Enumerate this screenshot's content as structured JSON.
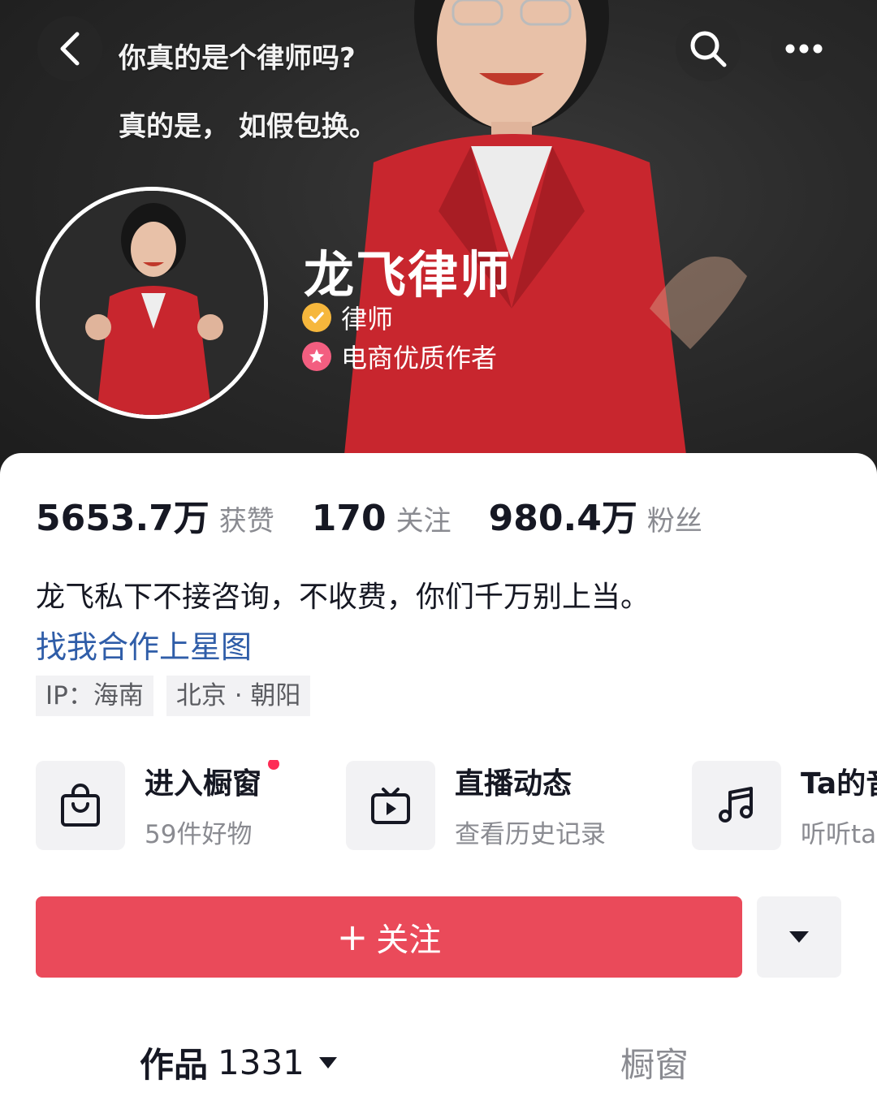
{
  "header": {
    "caption_line1": "你真的是个律师吗?",
    "caption_line2": "真的是， 如假包换。",
    "icons": [
      "chevron-left-icon",
      "search-icon",
      "more-icon"
    ]
  },
  "profile": {
    "name": "龙飞律师",
    "badges": [
      {
        "label": "律师",
        "icon": "verified-check-icon",
        "color": "#f6b73c"
      },
      {
        "label": "电商优质作者",
        "icon": "star-badge-icon",
        "color": "#f35e80"
      }
    ]
  },
  "stats": [
    {
      "value": "5653.7万",
      "label": "获赞"
    },
    {
      "value": "170",
      "label": "关注"
    },
    {
      "value": "980.4万",
      "label": "粉丝"
    }
  ],
  "bio": {
    "text": "龙飞私下不接咨询，不收费，你们千万别上当。",
    "link": "找我合作上星图"
  },
  "chips": [
    "IP：海南",
    "北京 · 朝阳"
  ],
  "features": [
    {
      "title": "进入橱窗",
      "subtitle": "59件好物",
      "icon": "shopping-bag-icon",
      "has_dot": true
    },
    {
      "title": "直播动态",
      "subtitle": "查看历史记录",
      "icon": "tv-play-icon"
    },
    {
      "title": "Ta的音乐",
      "subtitle": "听听ta的音乐",
      "icon": "music-note-icon"
    }
  ],
  "actions": {
    "follow_plus": "+",
    "follow_label": "关注"
  },
  "tabs": {
    "works_label": "作品",
    "works_count": "1331",
    "shop_label": "橱窗"
  },
  "colors": {
    "accent": "#ea4a5a",
    "link": "#2f5da8",
    "muted": "#8a8b91",
    "dot": "#fe2c55"
  }
}
